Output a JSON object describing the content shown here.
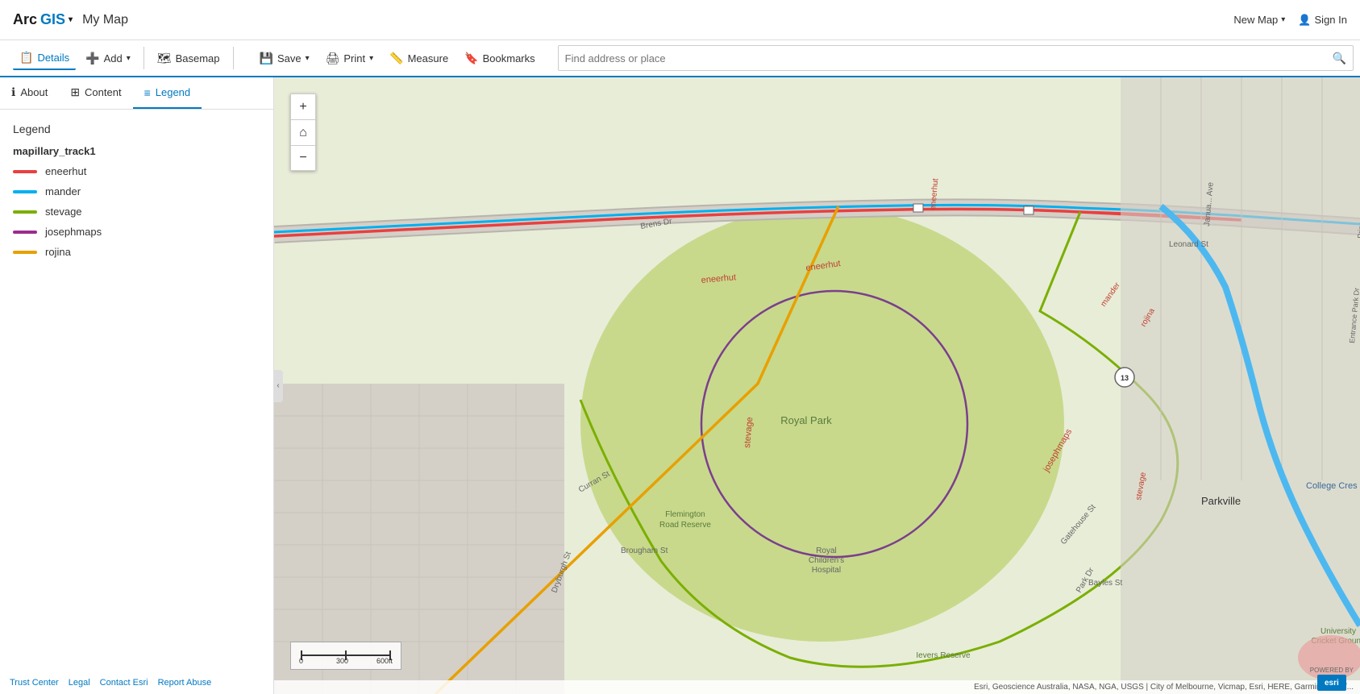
{
  "app": {
    "name_arc": "Arc",
    "name_gis": "GIS",
    "title": "My Map",
    "new_map_label": "New Map",
    "sign_in_label": "Sign In"
  },
  "toolbar": {
    "details_label": "Details",
    "add_label": "Add",
    "basemap_label": "Basemap",
    "save_label": "Save",
    "print_label": "Print",
    "measure_label": "Measure",
    "bookmarks_label": "Bookmarks",
    "search_placeholder": "Find address or place"
  },
  "sidebar": {
    "tab_about": "About",
    "tab_content": "Content",
    "tab_legend": "Legend",
    "legend_title": "Legend",
    "layer_title": "mapillary_track1",
    "legend_items": [
      {
        "label": "eneerhut",
        "color": "#e84040"
      },
      {
        "label": "mander",
        "color": "#00b0f0"
      },
      {
        "label": "stevage",
        "color": "#7aaf00"
      },
      {
        "label": "josephmaps",
        "color": "#9b2d8e"
      },
      {
        "label": "rojina",
        "color": "#e8a000"
      }
    ]
  },
  "map_controls": {
    "zoom_in": "+",
    "home": "⌂",
    "zoom_out": "−"
  },
  "scale_bar": {
    "labels": [
      "0",
      "300",
      "600ft"
    ]
  },
  "attribution": "Esri, Geoscience Australia, NASA, NGA, USGS | City of Melbourne, Vicmap, Esri, HERE, Garmin, METI/...",
  "footer": {
    "trust_center": "Trust Center",
    "legal": "Legal",
    "contact_esri": "Contact Esri",
    "report_abuse": "Report Abuse"
  },
  "esri_logo": {
    "powered_by": "POWERED BY",
    "esri": "esri"
  }
}
